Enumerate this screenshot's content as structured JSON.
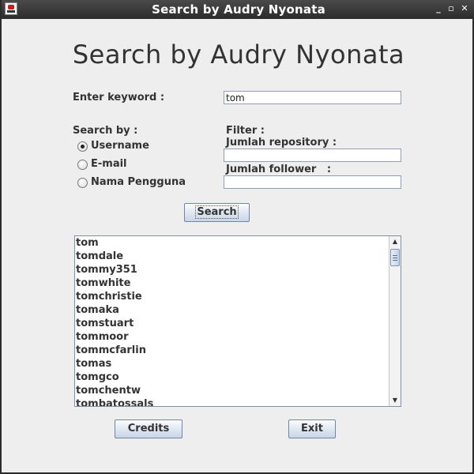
{
  "window": {
    "title": "Search by Audry Nyonata",
    "controls": {
      "minimize": "_",
      "maximize": "▫",
      "close": "✕"
    }
  },
  "heading": "Search by Audry Nyonata",
  "keyword": {
    "label": "Enter keyword :",
    "value": "tom"
  },
  "search_by": {
    "label": "Search by :",
    "options": [
      {
        "label": "Username",
        "checked": true
      },
      {
        "label": "E-mail",
        "checked": false
      },
      {
        "label": "Nama Pengguna",
        "checked": false
      }
    ]
  },
  "filter": {
    "label": "Filter :",
    "repo_label": "Jumlah repository :",
    "repo_value": "",
    "follower_label": "Jumlah follower   :",
    "follower_value": ""
  },
  "buttons": {
    "search": "Search",
    "credits": "Credits",
    "exit": "Exit"
  },
  "results": [
    "tom",
    "tomdale",
    "tommy351",
    "tomwhite",
    "tomchristie",
    "tomaka",
    "tomstuart",
    "tommoor",
    "tommcfarlin",
    "tomas",
    "tomgco",
    "tomchentw",
    "tombatossals"
  ],
  "scrollbar": {
    "up": "▲",
    "down": "▼"
  }
}
